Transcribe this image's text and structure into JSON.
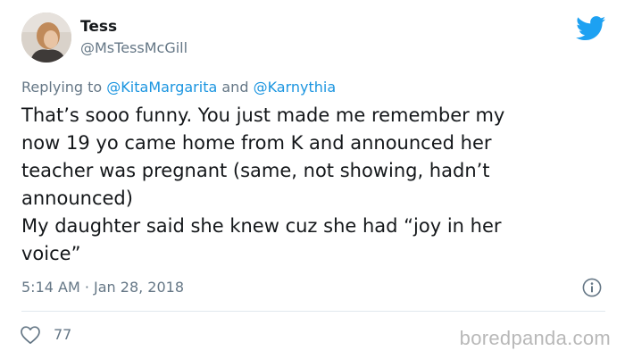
{
  "author": {
    "display_name": "Tess",
    "handle": "@MsTessMcGill"
  },
  "reply": {
    "prefix": "Replying to ",
    "mention_1": "@KitaMargarita",
    "joiner": " and ",
    "mention_2": "@Karnythia"
  },
  "tweet": {
    "lines": [
      "That’s sooo funny. You just made me remember my",
      "now 19 yo came home from K and announced her",
      "teacher was pregnant (same, not showing, hadn’t",
      "announced)",
      "My daughter said she knew cuz she had “joy in her",
      "voice”"
    ],
    "timestamp": "5:14 AM · Jan 28, 2018",
    "likes": "77"
  },
  "icons": {
    "brand": "twitter-bird-icon",
    "info": "info-icon",
    "like": "heart-icon"
  },
  "colors": {
    "brand_blue": "#1da1f2",
    "link_blue": "#1b95e0",
    "secondary_text": "#657786",
    "primary_text": "#14171a"
  },
  "watermark": "boredpanda.com"
}
